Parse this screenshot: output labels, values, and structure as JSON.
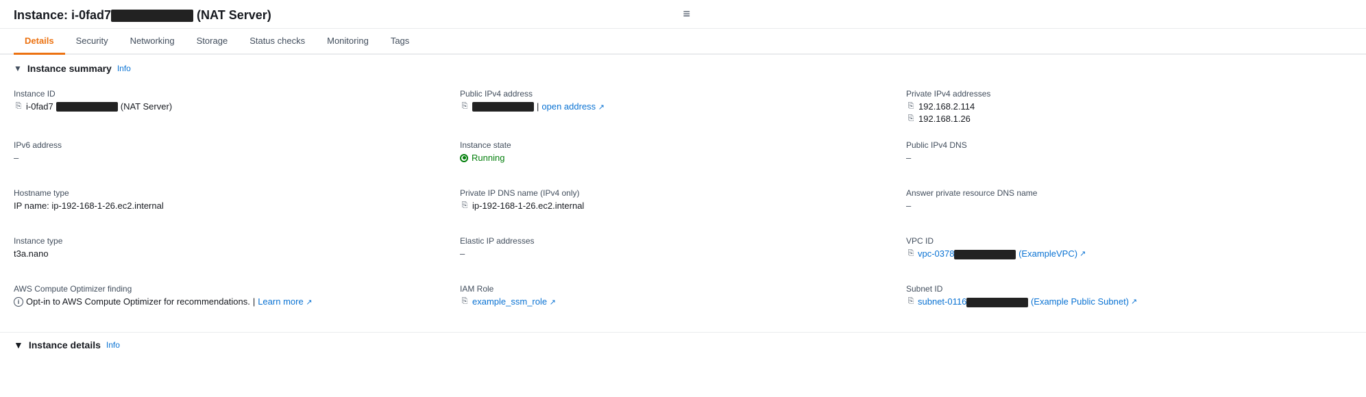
{
  "page": {
    "title_prefix": "Instance: i-0fad7",
    "title_suffix": " (NAT Server)",
    "hamburger": "≡"
  },
  "tabs": [
    {
      "id": "details",
      "label": "Details",
      "active": true
    },
    {
      "id": "security",
      "label": "Security",
      "active": false
    },
    {
      "id": "networking",
      "label": "Networking",
      "active": false
    },
    {
      "id": "storage",
      "label": "Storage",
      "active": false
    },
    {
      "id": "status-checks",
      "label": "Status checks",
      "active": false
    },
    {
      "id": "monitoring",
      "label": "Monitoring",
      "active": false
    },
    {
      "id": "tags",
      "label": "Tags",
      "active": false
    }
  ],
  "instance_summary": {
    "section_label": "Instance summary",
    "info_label": "Info",
    "fields": {
      "instance_id": {
        "label": "Instance ID",
        "value_prefix": "i-0fad7",
        "value_suffix": " (NAT Server)"
      },
      "ipv6_address": {
        "label": "IPv6 address",
        "value": "–"
      },
      "hostname_type": {
        "label": "Hostname type",
        "value": "IP name: ip-192-168-1-26.ec2.internal"
      },
      "instance_type": {
        "label": "Instance type",
        "value": "t3a.nano"
      },
      "aws_compute_optimizer": {
        "label": "AWS Compute Optimizer finding",
        "text": "Opt-in to AWS Compute Optimizer for recommendations.",
        "learn_more": "Learn more",
        "separator": " | "
      },
      "public_ipv4": {
        "label": "Public IPv4 address",
        "open_address": "open address"
      },
      "instance_state": {
        "label": "Instance state",
        "value": "Running"
      },
      "private_ip_dns": {
        "label": "Private IP DNS name (IPv4 only)",
        "value": "ip-192-168-1-26.ec2.internal"
      },
      "elastic_ip": {
        "label": "Elastic IP addresses",
        "value": "–"
      },
      "iam_role": {
        "label": "IAM Role",
        "value": "example_ssm_role"
      },
      "private_ipv4_addresses": {
        "label": "Private IPv4 addresses",
        "values": [
          "192.168.2.114",
          "192.168.1.26"
        ]
      },
      "public_ipv4_dns": {
        "label": "Public IPv4 DNS",
        "value": "–"
      },
      "answer_private_dns": {
        "label": "Answer private resource DNS name",
        "value": "–"
      },
      "vpc_id": {
        "label": "VPC ID",
        "value_prefix": "vpc-0378",
        "value_suffix": " (ExampleVPC)"
      },
      "subnet_id": {
        "label": "Subnet ID",
        "value_prefix": "subnet-0116",
        "value_suffix": " (Example Public Subnet)"
      }
    }
  },
  "instance_details": {
    "section_label": "Instance details",
    "info_label": "Info"
  }
}
